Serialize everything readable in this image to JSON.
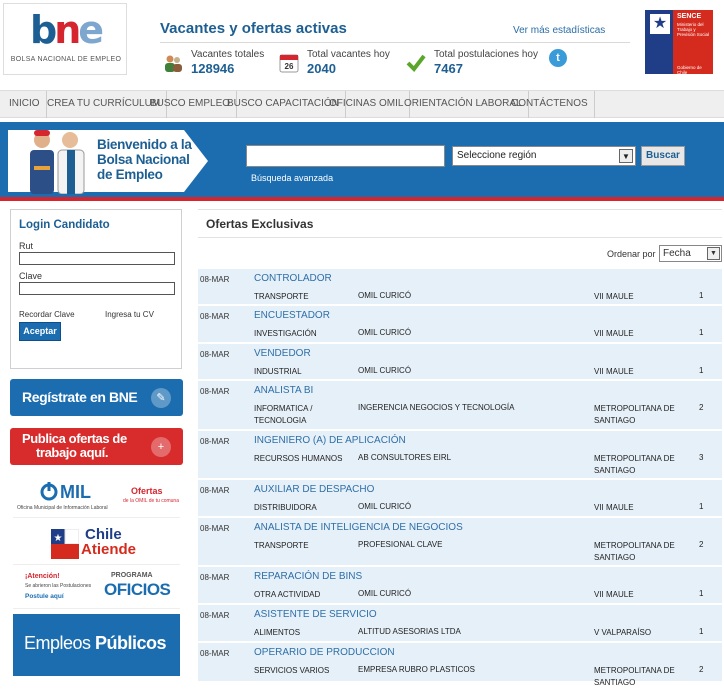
{
  "brand": {
    "logo_text": "bne",
    "logo_subtitle": "BOLSA NACIONAL DE EMPLEO",
    "colors": {
      "b": "#1d5f93",
      "n": "#d5262f",
      "e": "#7ea7cf"
    }
  },
  "stats": {
    "title": "Vacantes y ofertas activas",
    "more_link": "Ver más estadísticas",
    "items": [
      {
        "label": "Vacantes totales",
        "value": "128946",
        "icon": "people-icon"
      },
      {
        "label": "Total vacantes hoy",
        "value": "2040",
        "icon": "calendar-icon",
        "day": "26"
      },
      {
        "label": "Total postulaciones hoy",
        "value": "7467",
        "icon": "check-icon"
      }
    ],
    "twitter_glyph": "t"
  },
  "sence": {
    "title": "SENCE",
    "subtitle": "Ministerio del Trabajo y Previsión Social",
    "footer": "Gobierno de Chile"
  },
  "nav": {
    "items": [
      "INICIO",
      "CREA TU CURRÍCULUM",
      "BUSCO EMPLEO",
      "BUSCO CAPACITACIÓN",
      "OFICINAS OMIL",
      "ORIENTACIÓN LABORAL",
      "CONTÁCTENOS"
    ]
  },
  "banner": {
    "welcome_lines": [
      "Bienvenido a la",
      "Bolsa Nacional",
      "de Empleo"
    ]
  },
  "search": {
    "input_value": "",
    "region_placeholder": "Seleccione región",
    "button_label": "Buscar",
    "advanced_link": "Búsqueda avanzada"
  },
  "login": {
    "title": "Login Candidato",
    "rut_label": "Rut",
    "clave_label": "Clave",
    "remember_link": "Recordar Clave",
    "cv_link": "Ingresa tu CV",
    "submit_label": "Aceptar"
  },
  "sidebar": {
    "register_label": "Regístrate en BNE",
    "publish_lines": [
      "Publica ofertas de",
      "trabajo aquí."
    ],
    "omil": {
      "name": "MIL",
      "subtitle": "Oficina Municipal de Información Laboral",
      "offers_title": "Ofertas",
      "offers_sub": "de la OMIL de tu comuna"
    },
    "chile_atiende": {
      "line1": "Chile",
      "line2": "Atiende"
    },
    "oficios": {
      "alert": "¡Atención!",
      "alert_sub": "Se abrieron las Postulaciones",
      "alert_link": "Postule aquí",
      "program": "PROGRAMA",
      "name": "OFICIOS"
    },
    "empleos": {
      "part1": "Empleos ",
      "part2": "Públicos"
    }
  },
  "offers": {
    "title": "Ofertas Exclusivas",
    "order_label": "Ordenar por",
    "order_value": "Fecha",
    "items": [
      {
        "date": "08-MAR",
        "title": "CONTROLADOR",
        "category": "TRANSPORTE",
        "company": "OMIL CURICÓ",
        "region": "VII MAULE",
        "count": "1"
      },
      {
        "date": "08-MAR",
        "title": "ENCUESTADOR",
        "category": "INVESTIGACIÓN",
        "company": "OMIL CURICÓ",
        "region": "VII MAULE",
        "count": "1"
      },
      {
        "date": "08-MAR",
        "title": "VENDEDOR",
        "category": "INDUSTRIAL",
        "company": "OMIL CURICÓ",
        "region": "VII MAULE",
        "count": "1"
      },
      {
        "date": "08-MAR",
        "title": "ANALISTA BI",
        "category": "INFORMATICA / TECNOLOGIA",
        "company": "INGERENCIA NEGOCIOS Y TECNOLOGÍA",
        "region": "METROPOLITANA DE SANTIAGO",
        "count": "2"
      },
      {
        "date": "08-MAR",
        "title": "INGENIERO (A) DE APLICACIÓN",
        "category": "RECURSOS HUMANOS",
        "company": "AB CONSULTORES EIRL",
        "region": "METROPOLITANA DE SANTIAGO",
        "count": "3"
      },
      {
        "date": "08-MAR",
        "title": "AUXILIAR DE DESPACHO",
        "category": "DISTRIBUIDORA",
        "company": "OMIL CURICÓ",
        "region": "VII MAULE",
        "count": "1"
      },
      {
        "date": "08-MAR",
        "title": "ANALISTA DE INTELIGENCIA DE NEGOCIOS",
        "category": "TRANSPORTE",
        "company": "PROFESIONAL CLAVE",
        "region": "METROPOLITANA DE SANTIAGO",
        "count": "2"
      },
      {
        "date": "08-MAR",
        "title": "REPARACIÓN DE BINS",
        "category": "OTRA ACTIVIDAD",
        "company": "OMIL CURICÓ",
        "region": "VII MAULE",
        "count": "1"
      },
      {
        "date": "08-MAR",
        "title": "ASISTENTE DE SERVICIO",
        "category": "ALIMENTOS",
        "company": "ALTITUD ASESORIAS LTDA",
        "region": "V VALPARAÍSO",
        "count": "1"
      },
      {
        "date": "08-MAR",
        "title": "OPERARIO DE PRODUCCION",
        "category": "SERVICIOS VARIOS",
        "company": "EMPRESA RUBRO PLASTICOS",
        "region": "METROPOLITANA DE SANTIAGO",
        "count": "2"
      }
    ]
  }
}
